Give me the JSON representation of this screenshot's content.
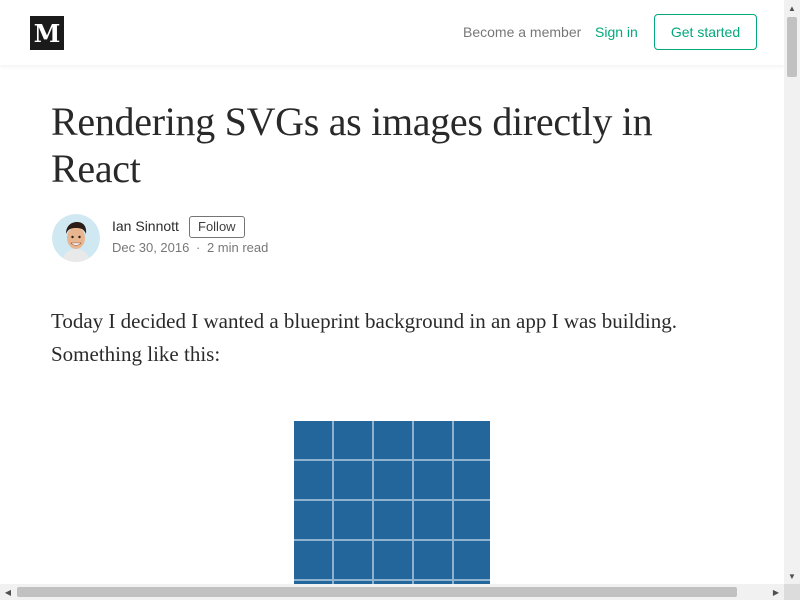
{
  "header": {
    "logo_letter": "M",
    "become_member": "Become a member",
    "sign_in": "Sign in",
    "get_started": "Get started"
  },
  "article": {
    "title": "Rendering SVGs as images directly in React",
    "author": "Ian Sinnott",
    "follow": "Follow",
    "date": "Dec 30, 2016",
    "separator": "·",
    "read_time": "2 min read",
    "intro": "Today I decided I wanted a blueprint background in an app I was building. Something like this:"
  },
  "figure": {
    "background_color": "#22669c",
    "grid_color": "#8fb3cf"
  },
  "colors": {
    "accent": "#03a87c",
    "logo_bg": "#1a1a1a"
  },
  "icons": {
    "scroll_up": "triangle-up",
    "scroll_down": "triangle-down",
    "scroll_left": "triangle-left",
    "scroll_right": "triangle-right"
  }
}
